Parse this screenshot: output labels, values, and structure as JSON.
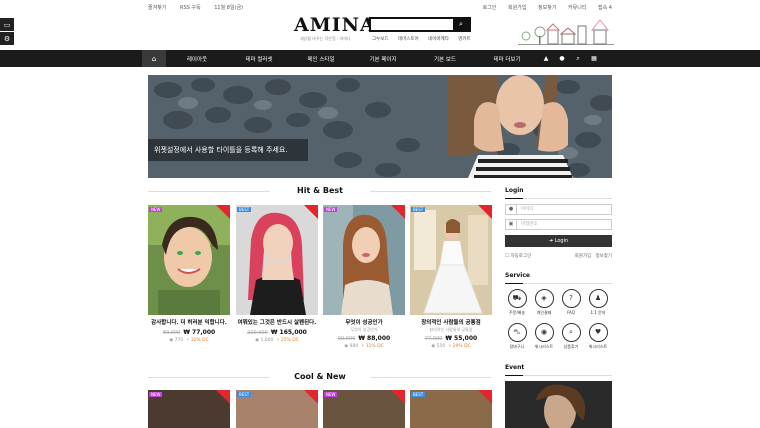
{
  "topbar": {
    "left": [
      "즐겨찾기",
      "RSS 구독",
      "11월 8일(금)"
    ],
    "right": [
      "로그인",
      "회원가입",
      "정보찾기",
      "커뮤니티",
      "접속 4"
    ]
  },
  "logo": "AMINA",
  "tagline": "세상을 바꾸는 작은힘 - 아미나",
  "search": {
    "placeholder": ""
  },
  "quick_links": [
    "그누보드",
    "테마스토어",
    "네이버메타",
    "영카트"
  ],
  "nav": [
    "레이아웃",
    "테마 컬러셋",
    "메인 스타일",
    "기본 페이지",
    "기본 보드",
    "테마 더보기"
  ],
  "banner": {
    "caption": "위젯설정에서 사용할 타이틀을 등록해 주세요."
  },
  "hit_title": "Hit & Best",
  "cool_title": "Cool & New",
  "products": [
    {
      "name": "감사합니다. 더 허러분 익합니다.",
      "sub": "",
      "old": "89,000",
      "price": "₩ 77,000",
      "views": "770",
      "discount": "32% DC",
      "tag_color": "#c03fd8"
    },
    {
      "name": "여쭤있는 그것은 반드시 살펜된다.",
      "sub": "",
      "old": "220,000",
      "price": "₩ 165,000",
      "views": "1,600",
      "discount": "25% DC",
      "tag_color": "#3a8de0"
    },
    {
      "name": "무엇이 성공인가",
      "sub": "무엇이 성공인가",
      "old": "99,000",
      "price": "₩ 88,000",
      "views": "880",
      "discount": "11% DC",
      "tag_color": "#c03fd8"
    },
    {
      "name": "창의적인 사람들의 공통점",
      "sub": "창의적인 사람들의 공통점",
      "old": "77,000",
      "price": "₩ 55,000",
      "views": "550",
      "discount": "29% DC",
      "tag_color": "#3a8de0"
    }
  ],
  "login": {
    "title": "Login",
    "id_placeholder": "아이디",
    "pw_placeholder": "비밀번호",
    "button": "Login",
    "remember": "자동로그인",
    "join": "회원가입",
    "find": "정보찾기"
  },
  "service": {
    "title": "Service",
    "items": [
      "주문/배송",
      "개인결제",
      "FAQ",
      "1:1 문의",
      "장바구니",
      "위시리스트",
      "상품찾기",
      "위시리스트"
    ]
  },
  "event_title": "Event",
  "icons": {
    "home": "home-icon",
    "search": "search-icon",
    "user": "user-icon",
    "lock": "lock-icon"
  }
}
